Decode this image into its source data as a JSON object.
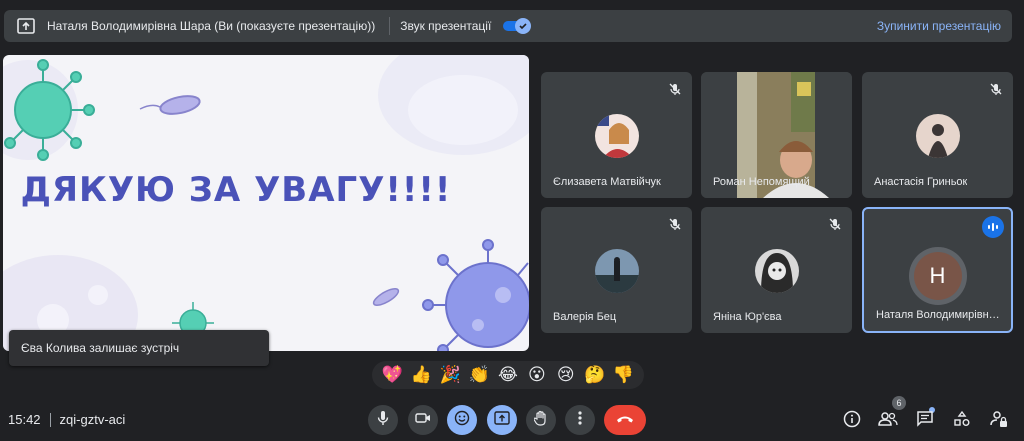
{
  "presenting_bar": {
    "title": "Наталя Володимирівна Шара (Ви (показуєте презентацію))",
    "sound_label": "Звук презентації",
    "sound_enabled": true,
    "stop_label": "Зупинити презентацію"
  },
  "slide": {
    "title": "ДЯКУЮ ЗА УВАГУ!!!!"
  },
  "toast": {
    "message": "Єва Колива залишає зустріч"
  },
  "participants": [
    {
      "name": "Єлизавета Матвійчук",
      "muted": true
    },
    {
      "name": "Роман Непомящий",
      "muted": false
    },
    {
      "name": "Анастасія Гриньок",
      "muted": true
    },
    {
      "name": "Валерія Бец",
      "muted": true
    },
    {
      "name": "Яніна Юр'єва",
      "muted": true
    },
    {
      "name": "Наталя Володимирівн…",
      "initial": "Н",
      "speaking": true
    }
  ],
  "reactions": [
    "💖",
    "👍",
    "🎉",
    "👏",
    "😂",
    "😮",
    "😢",
    "🤔",
    "👎"
  ],
  "meeting": {
    "time": "15:42",
    "code": "zqi-gztv-aci"
  },
  "people_count": "6",
  "colors": {
    "accent": "#8ab4f8",
    "hangup": "#ea4335",
    "slide_title": "#4a52b8"
  }
}
